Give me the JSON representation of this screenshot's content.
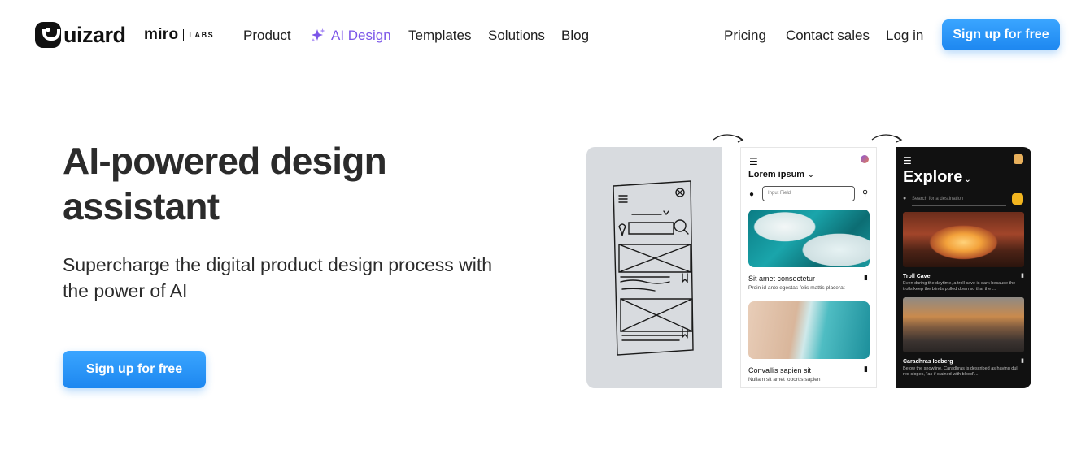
{
  "brand": {
    "name": "uizard",
    "partner": "miro",
    "partner_tag": "LABS"
  },
  "nav": {
    "left": [
      "Product",
      "AI Design",
      "Templates",
      "Solutions",
      "Blog"
    ],
    "right": [
      "Pricing",
      "Contact sales",
      "Log in"
    ],
    "cta": "Sign up for free",
    "active_color": "#7b55e8"
  },
  "hero": {
    "title": "AI-powered design assistant",
    "subtitle": "Supercharge the digital product design process with the power of AI",
    "cta": "Sign up for free"
  },
  "mockup": {
    "wire": {
      "title": "Lorem ipsum",
      "input_placeholder": "Input Field",
      "cards": [
        {
          "title": "Sit amet consectetur",
          "desc": "Proin id ante egestas felis mattis placerat"
        },
        {
          "title": "Convallis sapien sit",
          "desc": "Nullam sit amet lobortis sapien"
        }
      ]
    },
    "dark": {
      "title": "Explore",
      "search_placeholder": "Search for a destination",
      "cards": [
        {
          "title": "Troll Cave",
          "desc": "Even during the daytime, a troll cave is dark because the trolls keep the blinds pulled down so that the ..."
        },
        {
          "title": "Caradhras Iceberg",
          "desc": "Below the snowline, Caradhras is described as having dull red slopes, \"as if stained with blood\"..."
        }
      ]
    }
  },
  "colors": {
    "cta_blue": "#1d87f0",
    "ai_purple": "#7b55e8",
    "dark_panel": "#111111"
  }
}
